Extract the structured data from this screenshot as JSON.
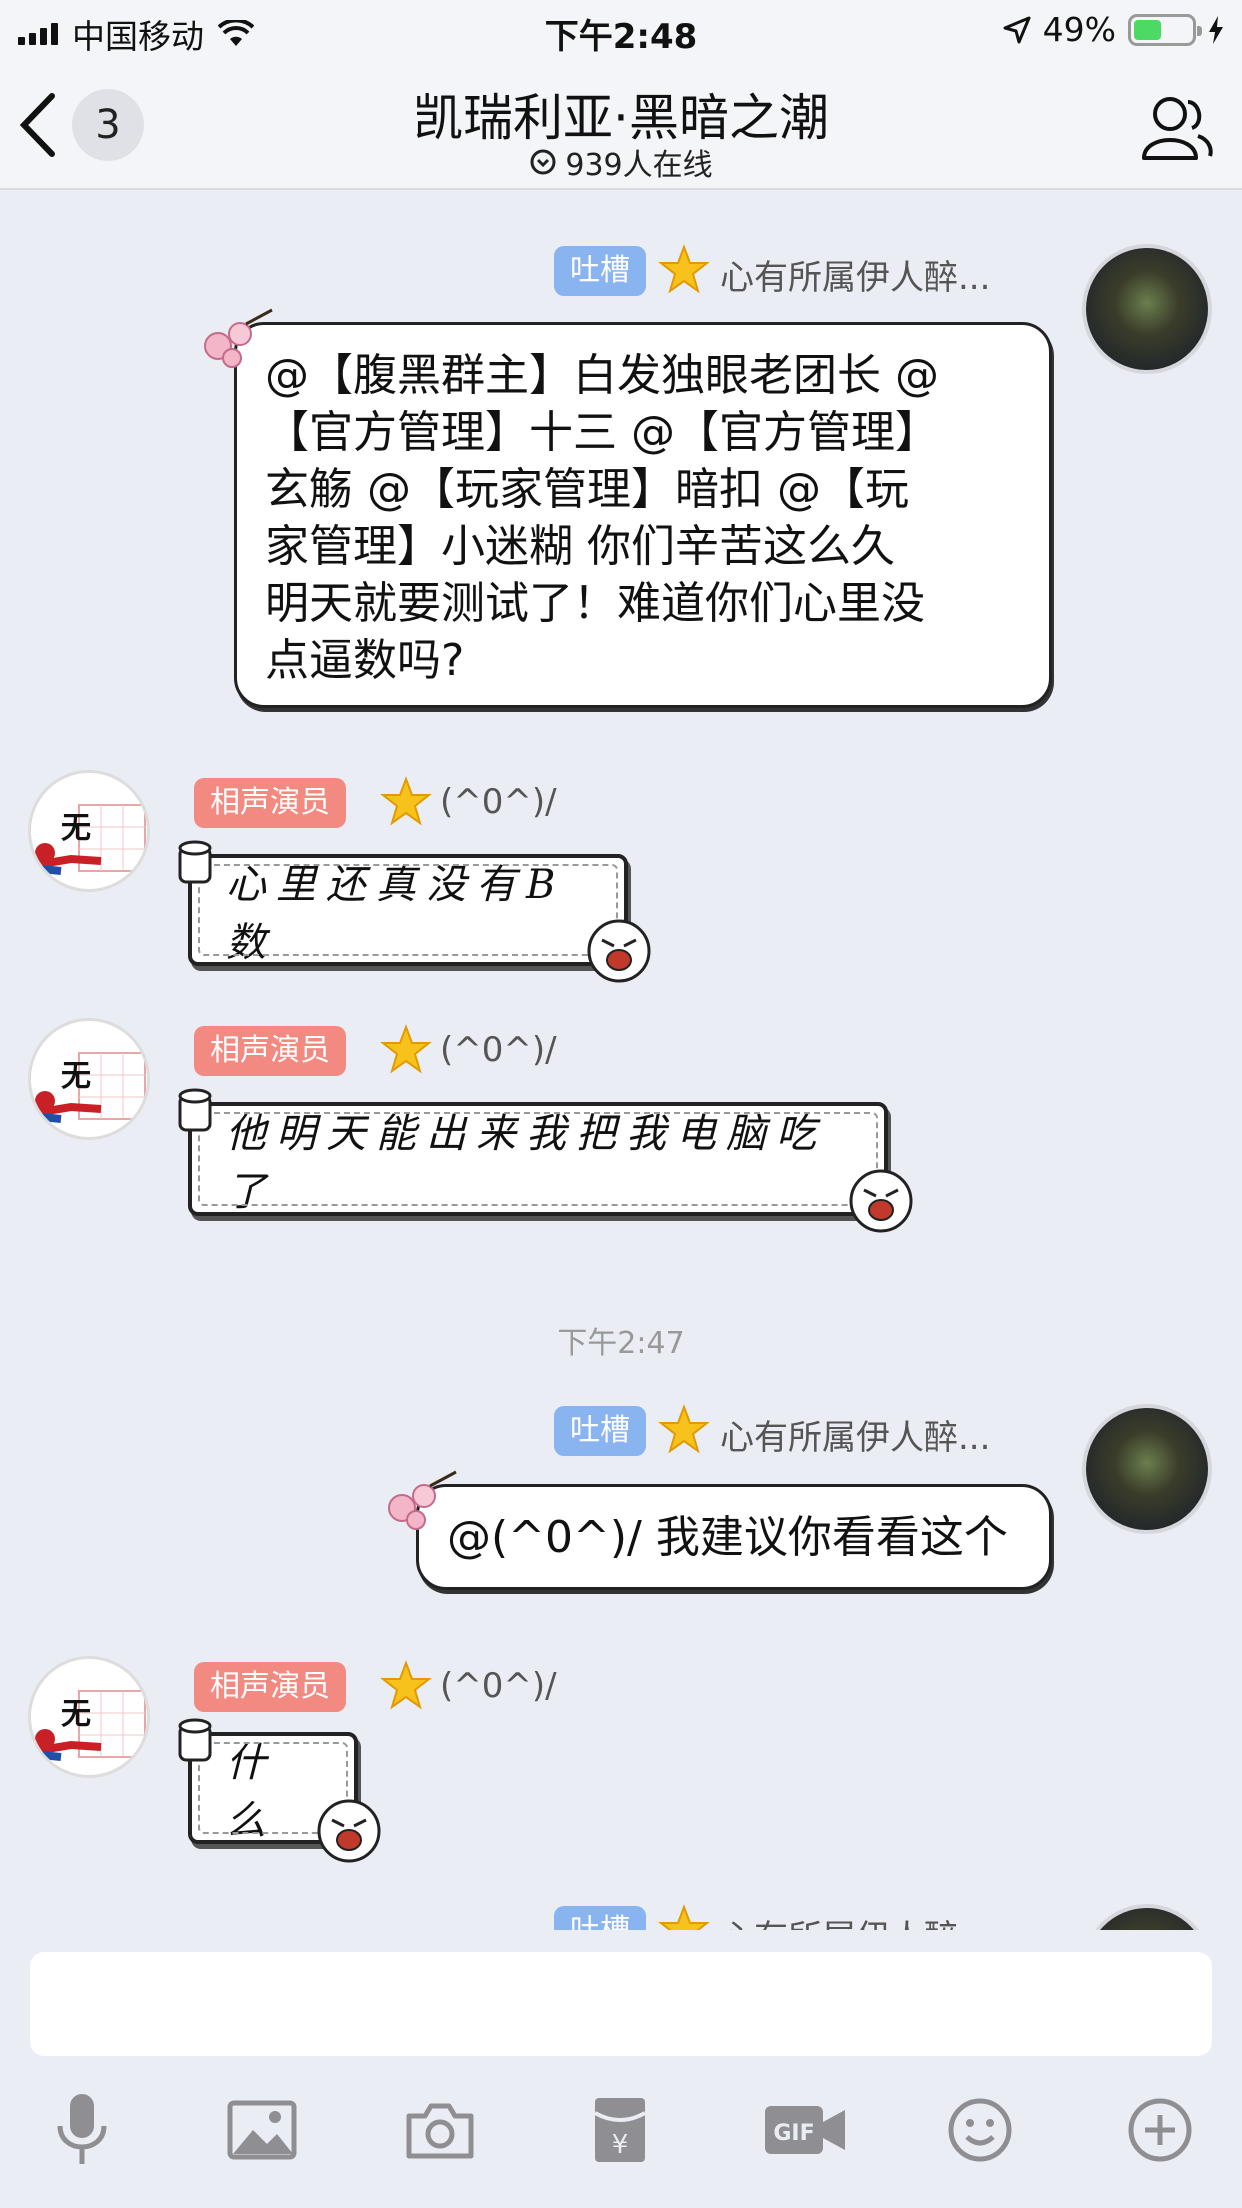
{
  "status_bar": {
    "carrier": "中国移动",
    "time": "下午2:48",
    "battery_percent": "49%",
    "battery_level": 0.49
  },
  "nav": {
    "back_count": "3",
    "title": "凯瑞利亚·黑暗之潮",
    "online_text": "939人在线"
  },
  "chat": {
    "timestamp": "下午2:47",
    "messages": [
      {
        "sender_tag": "吐槽",
        "sender_name": "心有所属伊人醉...",
        "text_lines": [
          "@【腹黑群主】白发独眼老团长 @",
          "【官方管理】十三 @【官方管理】",
          "玄觞 @【玩家管理】暗扣 @【玩",
          "家管理】小迷糊 你们辛苦这么久",
          "明天就要测试了！难道你们心里没",
          "点逼数吗?"
        ]
      },
      {
        "sender_tag": "相声演员",
        "sender_name": "(^0^)/",
        "avatar_text": "无",
        "text": "心里还真没有B数"
      },
      {
        "sender_tag": "相声演员",
        "sender_name": "(^0^)/",
        "avatar_text": "无",
        "text": "他明天能出来我把我电脑吃了"
      },
      {
        "sender_tag": "吐槽",
        "sender_name": "心有所属伊人醉...",
        "text": "@(^0^)/ 我建议你看看这个"
      },
      {
        "sender_tag": "相声演员",
        "sender_name": "(^0^)/",
        "avatar_text": "无",
        "text": "什么"
      },
      {
        "sender_tag": "吐槽",
        "sender_name": "心有所属伊人醉..."
      }
    ]
  },
  "input": {
    "value": ""
  },
  "toolbar": {
    "icons": [
      "microphone-icon",
      "image-icon",
      "camera-icon",
      "red-packet-icon",
      "gif-icon",
      "emoji-icon",
      "plus-icon"
    ]
  },
  "colors": {
    "tag_blue": "#8ab4ef",
    "tag_red": "#f28a82",
    "background": "#ebedf5",
    "battery_green": "#4cd964"
  }
}
